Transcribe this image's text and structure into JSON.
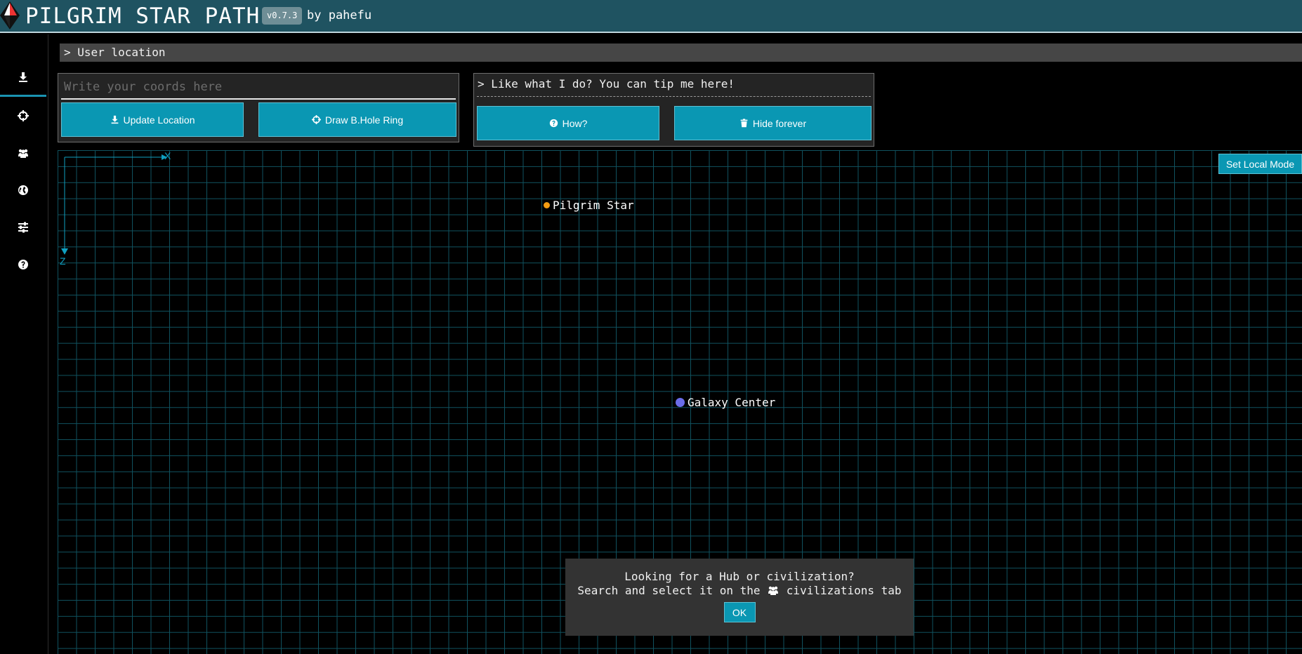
{
  "header": {
    "title": "PILGRIM STAR PATH",
    "version": "v0.7.3",
    "author": "by pahefu"
  },
  "sidebar": {
    "items": [
      {
        "icon": "user-location-icon",
        "active": true
      },
      {
        "icon": "crosshair-icon",
        "active": false
      },
      {
        "icon": "users-icon",
        "active": false
      },
      {
        "icon": "globe-icon",
        "active": false
      },
      {
        "icon": "sliders-icon",
        "active": false
      },
      {
        "icon": "help-icon",
        "active": false
      }
    ]
  },
  "location_section": {
    "heading": "> User location",
    "coords_placeholder": "Write your coords here",
    "update_label": "Update Location",
    "ring_label": "Draw B.Hole Ring"
  },
  "tip_section": {
    "text": "> Like what I do? You can tip me here!",
    "how_label": "How?",
    "hide_label": "Hide forever"
  },
  "map": {
    "axis_x": "X",
    "axis_z": "Z",
    "local_mode_label": "Set Local Mode",
    "markers": [
      {
        "name": "Pilgrim Star",
        "color": "#f39c12"
      },
      {
        "name": "Galaxy Center",
        "color": "#6a6ce8"
      }
    ]
  },
  "toast": {
    "line1": "Looking for a Hub or civilization?",
    "line2_pre": "Search and select it on the",
    "line2_post": "civilizations tab",
    "ok_label": "OK"
  },
  "colors": {
    "header_bg": "#1f5361",
    "accent": "#0a97b3",
    "grid": "#10525f"
  }
}
